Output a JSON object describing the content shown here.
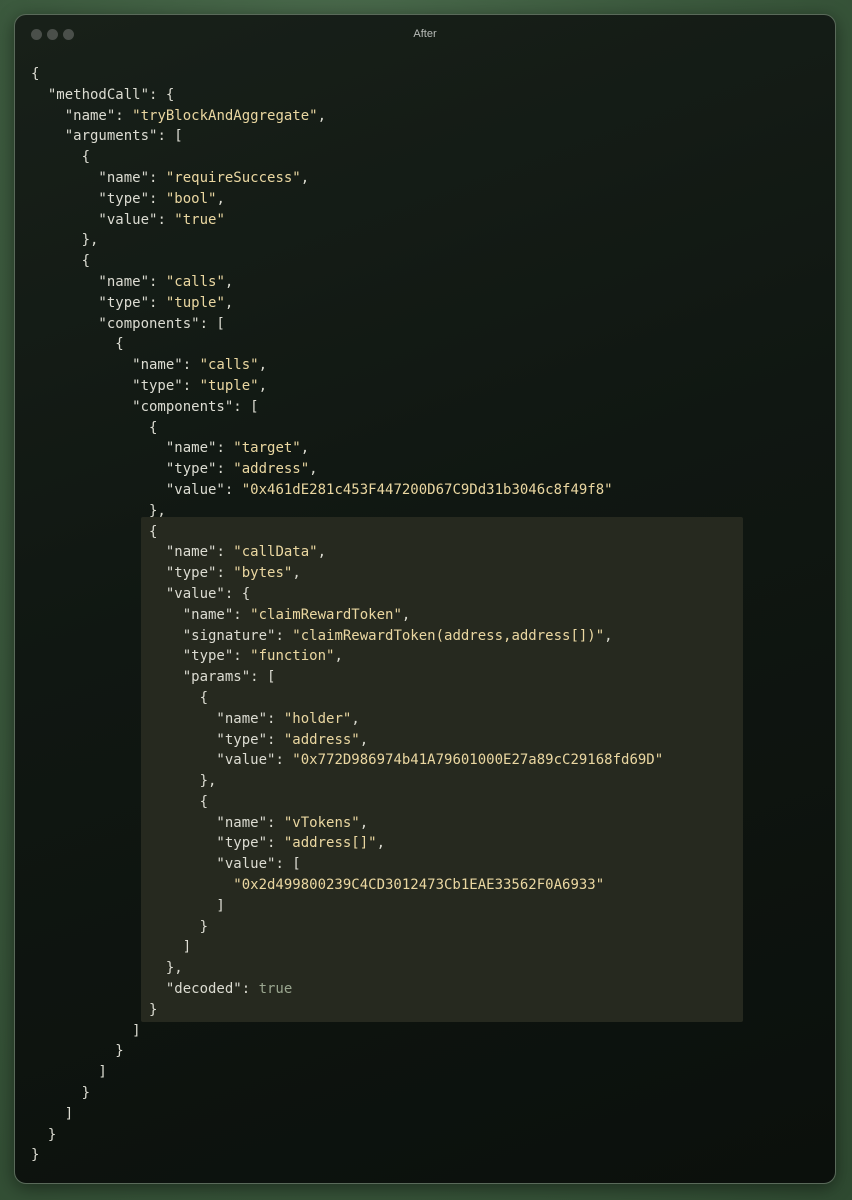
{
  "window": {
    "title": "After"
  },
  "code_lines": [
    [
      {
        "t": "{",
        "c": "p"
      }
    ],
    [
      {
        "t": "  \"methodCall\"",
        "c": "k"
      },
      {
        "t": ": {",
        "c": "p"
      }
    ],
    [
      {
        "t": "    \"name\"",
        "c": "k"
      },
      {
        "t": ": ",
        "c": "p"
      },
      {
        "t": "\"tryBlockAndAggregate\"",
        "c": "s"
      },
      {
        "t": ",",
        "c": "p"
      }
    ],
    [
      {
        "t": "    \"arguments\"",
        "c": "k"
      },
      {
        "t": ": [",
        "c": "p"
      }
    ],
    [
      {
        "t": "      {",
        "c": "p"
      }
    ],
    [
      {
        "t": "        \"name\"",
        "c": "k"
      },
      {
        "t": ": ",
        "c": "p"
      },
      {
        "t": "\"requireSuccess\"",
        "c": "s"
      },
      {
        "t": ",",
        "c": "p"
      }
    ],
    [
      {
        "t": "        \"type\"",
        "c": "k"
      },
      {
        "t": ": ",
        "c": "p"
      },
      {
        "t": "\"bool\"",
        "c": "s"
      },
      {
        "t": ",",
        "c": "p"
      }
    ],
    [
      {
        "t": "        \"value\"",
        "c": "k"
      },
      {
        "t": ": ",
        "c": "p"
      },
      {
        "t": "\"true\"",
        "c": "s"
      }
    ],
    [
      {
        "t": "      },",
        "c": "p"
      }
    ],
    [
      {
        "t": "      {",
        "c": "p"
      }
    ],
    [
      {
        "t": "        \"name\"",
        "c": "k"
      },
      {
        "t": ": ",
        "c": "p"
      },
      {
        "t": "\"calls\"",
        "c": "s"
      },
      {
        "t": ",",
        "c": "p"
      }
    ],
    [
      {
        "t": "        \"type\"",
        "c": "k"
      },
      {
        "t": ": ",
        "c": "p"
      },
      {
        "t": "\"tuple\"",
        "c": "s"
      },
      {
        "t": ",",
        "c": "p"
      }
    ],
    [
      {
        "t": "        \"components\"",
        "c": "k"
      },
      {
        "t": ": [",
        "c": "p"
      }
    ],
    [
      {
        "t": "          {",
        "c": "p"
      }
    ],
    [
      {
        "t": "            \"name\"",
        "c": "k"
      },
      {
        "t": ": ",
        "c": "p"
      },
      {
        "t": "\"calls\"",
        "c": "s"
      },
      {
        "t": ",",
        "c": "p"
      }
    ],
    [
      {
        "t": "            \"type\"",
        "c": "k"
      },
      {
        "t": ": ",
        "c": "p"
      },
      {
        "t": "\"tuple\"",
        "c": "s"
      },
      {
        "t": ",",
        "c": "p"
      }
    ],
    [
      {
        "t": "            \"components\"",
        "c": "k"
      },
      {
        "t": ": [",
        "c": "p"
      }
    ],
    [
      {
        "t": "              {",
        "c": "p"
      }
    ],
    [
      {
        "t": "                \"name\"",
        "c": "k"
      },
      {
        "t": ": ",
        "c": "p"
      },
      {
        "t": "\"target\"",
        "c": "s"
      },
      {
        "t": ",",
        "c": "p"
      }
    ],
    [
      {
        "t": "                \"type\"",
        "c": "k"
      },
      {
        "t": ": ",
        "c": "p"
      },
      {
        "t": "\"address\"",
        "c": "s"
      },
      {
        "t": ",",
        "c": "p"
      }
    ],
    [
      {
        "t": "                \"value\"",
        "c": "k"
      },
      {
        "t": ": ",
        "c": "p"
      },
      {
        "t": "\"0x461dE281c453F447200D67C9Dd31b3046c8f49f8\"",
        "c": "s"
      }
    ],
    [
      {
        "t": "              },",
        "c": "p"
      }
    ],
    [
      {
        "t": "              {",
        "c": "p"
      }
    ],
    [
      {
        "t": "                \"name\"",
        "c": "k"
      },
      {
        "t": ": ",
        "c": "p"
      },
      {
        "t": "\"callData\"",
        "c": "s"
      },
      {
        "t": ",",
        "c": "p"
      }
    ],
    [
      {
        "t": "                \"type\"",
        "c": "k"
      },
      {
        "t": ": ",
        "c": "p"
      },
      {
        "t": "\"bytes\"",
        "c": "s"
      },
      {
        "t": ",",
        "c": "p"
      }
    ],
    [
      {
        "t": "                \"value\"",
        "c": "k"
      },
      {
        "t": ": {",
        "c": "p"
      }
    ],
    [
      {
        "t": "                  \"name\"",
        "c": "k"
      },
      {
        "t": ": ",
        "c": "p"
      },
      {
        "t": "\"claimRewardToken\"",
        "c": "s"
      },
      {
        "t": ",",
        "c": "p"
      }
    ],
    [
      {
        "t": "                  \"signature\"",
        "c": "k"
      },
      {
        "t": ": ",
        "c": "p"
      },
      {
        "t": "\"claimRewardToken(address,address[])\"",
        "c": "s"
      },
      {
        "t": ",",
        "c": "p"
      }
    ],
    [
      {
        "t": "                  \"type\"",
        "c": "k"
      },
      {
        "t": ": ",
        "c": "p"
      },
      {
        "t": "\"function\"",
        "c": "s"
      },
      {
        "t": ",",
        "c": "p"
      }
    ],
    [
      {
        "t": "                  \"params\"",
        "c": "k"
      },
      {
        "t": ": [",
        "c": "p"
      }
    ],
    [
      {
        "t": "                    {",
        "c": "p"
      }
    ],
    [
      {
        "t": "                      \"name\"",
        "c": "k"
      },
      {
        "t": ": ",
        "c": "p"
      },
      {
        "t": "\"holder\"",
        "c": "s"
      },
      {
        "t": ",",
        "c": "p"
      }
    ],
    [
      {
        "t": "                      \"type\"",
        "c": "k"
      },
      {
        "t": ": ",
        "c": "p"
      },
      {
        "t": "\"address\"",
        "c": "s"
      },
      {
        "t": ",",
        "c": "p"
      }
    ],
    [
      {
        "t": "                      \"value\"",
        "c": "k"
      },
      {
        "t": ": ",
        "c": "p"
      },
      {
        "t": "\"0x772D986974b41A79601000E27a89cC29168fd69D\"",
        "c": "s"
      }
    ],
    [
      {
        "t": "                    },",
        "c": "p"
      }
    ],
    [
      {
        "t": "                    {",
        "c": "p"
      }
    ],
    [
      {
        "t": "                      \"name\"",
        "c": "k"
      },
      {
        "t": ": ",
        "c": "p"
      },
      {
        "t": "\"vTokens\"",
        "c": "s"
      },
      {
        "t": ",",
        "c": "p"
      }
    ],
    [
      {
        "t": "                      \"type\"",
        "c": "k"
      },
      {
        "t": ": ",
        "c": "p"
      },
      {
        "t": "\"address[]\"",
        "c": "s"
      },
      {
        "t": ",",
        "c": "p"
      }
    ],
    [
      {
        "t": "                      \"value\"",
        "c": "k"
      },
      {
        "t": ": [",
        "c": "p"
      }
    ],
    [
      {
        "t": "                        \"0x2d499800239C4CD3012473Cb1EAE33562F0A6933\"",
        "c": "s"
      }
    ],
    [
      {
        "t": "                      ]",
        "c": "p"
      }
    ],
    [
      {
        "t": "                    }",
        "c": "p"
      }
    ],
    [
      {
        "t": "                  ]",
        "c": "p"
      }
    ],
    [
      {
        "t": "                },",
        "c": "p"
      }
    ],
    [
      {
        "t": "                \"decoded\"",
        "c": "k"
      },
      {
        "t": ": ",
        "c": "p"
      },
      {
        "t": "true",
        "c": "b"
      }
    ],
    [
      {
        "t": "              }",
        "c": "p"
      }
    ],
    [
      {
        "t": "            ]",
        "c": "p"
      }
    ],
    [
      {
        "t": "          }",
        "c": "p"
      }
    ],
    [
      {
        "t": "        ]",
        "c": "p"
      }
    ],
    [
      {
        "t": "      }",
        "c": "p"
      }
    ],
    [
      {
        "t": "    ]",
        "c": "p"
      }
    ],
    [
      {
        "t": "  }",
        "c": "p"
      }
    ],
    [
      {
        "t": "}",
        "c": "p"
      }
    ]
  ]
}
